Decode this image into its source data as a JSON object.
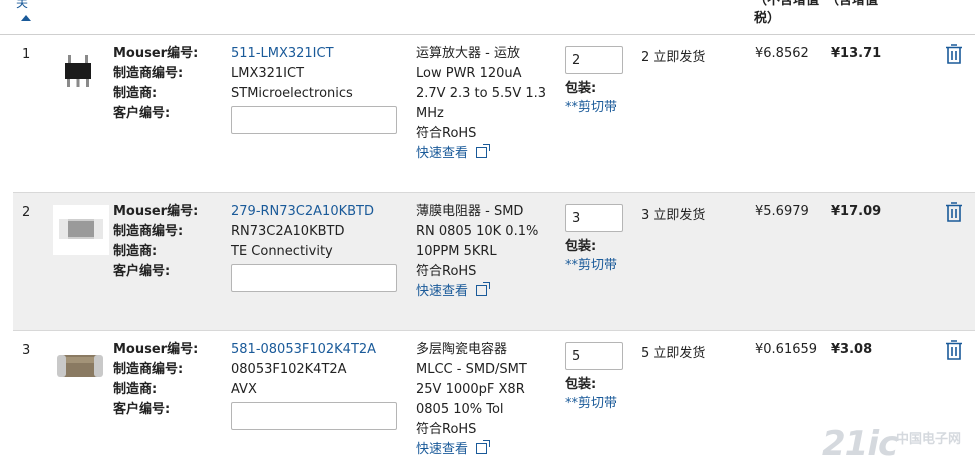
{
  "header": {
    "sort_label": "关",
    "unit_price_header": "（不含增值\n税）",
    "ext_price_header": "（含增值"
  },
  "labels": {
    "mouser_no": "Mouser编号:",
    "mfr_no": "制造商编号:",
    "mfr": "制造商:",
    "customer_no": "客户编号:",
    "package": "包装:",
    "quick_view": "快速查看"
  },
  "rows": [
    {
      "index": "1",
      "mouser_no": "511-LMX321ICT",
      "mfr_no": "LMX321ICT",
      "mfr": "STMicroelectronics",
      "desc": [
        "运算放大器 - 运放",
        "Low PWR 120uA",
        "2.7V 2.3 to 5.5V 1.3",
        "MHz",
        "符合RoHS"
      ],
      "qty": "2",
      "package": "**剪切带",
      "availability": "2 立即发货",
      "unit_price": "¥6.8562",
      "ext_price": "¥13.71"
    },
    {
      "index": "2",
      "mouser_no": "279-RN73C2A10KBTD",
      "mfr_no": "RN73C2A10KBTD",
      "mfr": "TE Connectivity",
      "desc": [
        "薄膜电阻器 - SMD",
        "RN 0805 10K 0.1%",
        "10PPM 5KRL",
        "符合RoHS"
      ],
      "qty": "3",
      "package": "**剪切带",
      "availability": "3 立即发货",
      "unit_price": "¥5.6979",
      "ext_price": "¥17.09"
    },
    {
      "index": "3",
      "mouser_no": "581-08053F102K4T2A",
      "mfr_no": "08053F102K4T2A",
      "mfr": "AVX",
      "desc": [
        "多层陶瓷电容器",
        "MLCC - SMD/SMT",
        "25V 1000pF X8R",
        "0805 10% Tol",
        "符合RoHS"
      ],
      "qty": "5",
      "package": "**剪切带",
      "availability": "5 立即发货",
      "unit_price": "¥0.61659",
      "ext_price": "¥3.08"
    }
  ],
  "watermark": {
    "text": "21ic",
    "subtext": "中国电子网"
  },
  "colors": {
    "link": "#1a5a99",
    "alt_row": "#efefef",
    "border": "#d8d8d8"
  }
}
